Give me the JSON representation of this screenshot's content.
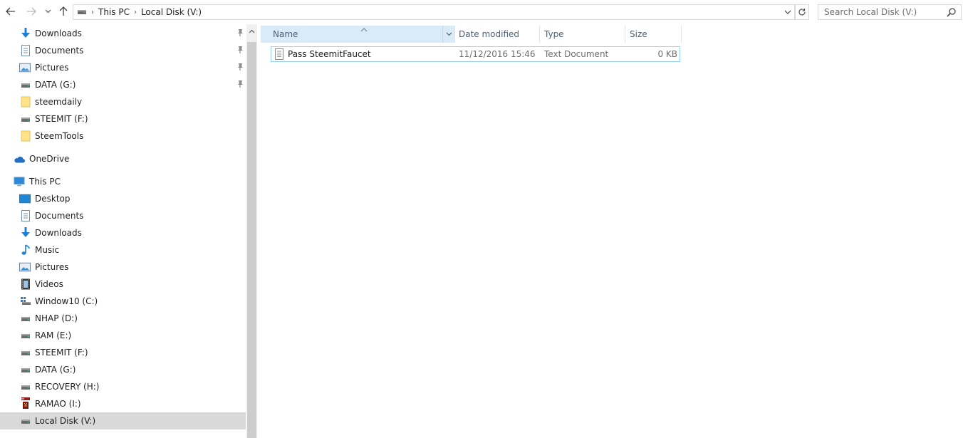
{
  "address": {
    "breadcrumbs": [
      "This PC",
      "Local Disk (V:)"
    ]
  },
  "search": {
    "placeholder": "Search Local Disk (V:)"
  },
  "sidebar": {
    "quick_access": [
      {
        "label": "Downloads",
        "icon": "download-arrow-icon",
        "pinned": true
      },
      {
        "label": "Documents",
        "icon": "document-icon",
        "pinned": true
      },
      {
        "label": "Pictures",
        "icon": "pictures-icon",
        "pinned": true
      },
      {
        "label": "DATA (G:)",
        "icon": "drive-icon",
        "pinned": true
      },
      {
        "label": "steemdaily",
        "icon": "folder-icon",
        "pinned": false
      },
      {
        "label": "STEEMIT (F:)",
        "icon": "drive-icon",
        "pinned": false
      },
      {
        "label": "SteemTools",
        "icon": "folder-icon",
        "pinned": false
      }
    ],
    "onedrive": {
      "label": "OneDrive",
      "icon": "onedrive-cloud-icon"
    },
    "this_pc": {
      "label": "This PC",
      "icon": "computer-icon"
    },
    "this_pc_items": [
      {
        "label": "Desktop",
        "icon": "desktop-icon"
      },
      {
        "label": "Documents",
        "icon": "document-icon"
      },
      {
        "label": "Downloads",
        "icon": "download-arrow-icon"
      },
      {
        "label": "Music",
        "icon": "music-note-icon"
      },
      {
        "label": "Pictures",
        "icon": "pictures-icon"
      },
      {
        "label": "Videos",
        "icon": "film-icon"
      },
      {
        "label": "Window10 (C:)",
        "icon": "windows-drive-icon"
      },
      {
        "label": "NHAP (D:)",
        "icon": "drive-icon"
      },
      {
        "label": "RAM (E:)",
        "icon": "drive-icon"
      },
      {
        "label": "STEEMIT (F:)",
        "icon": "drive-icon"
      },
      {
        "label": "DATA (G:)",
        "icon": "drive-icon"
      },
      {
        "label": "RECOVERY (H:)",
        "icon": "drive-icon"
      },
      {
        "label": "RAMAO (I:)",
        "icon": "sd-card-icon"
      },
      {
        "label": "Local Disk (V:)",
        "icon": "drive-icon",
        "selected": true
      }
    ]
  },
  "columns": [
    "Name",
    "Date modified",
    "Type",
    "Size"
  ],
  "files": [
    {
      "name": "Pass SteemitFaucet",
      "date_modified": "11/12/2016 15:46",
      "type": "Text Document",
      "size": "0 KB",
      "icon": "text-file-icon"
    }
  ],
  "colors": {
    "selection_bg": "#d9d9d9",
    "header_active_bg": "#d9ebf9",
    "row_border": "#99d1ff",
    "header_text": "#4c607a"
  }
}
